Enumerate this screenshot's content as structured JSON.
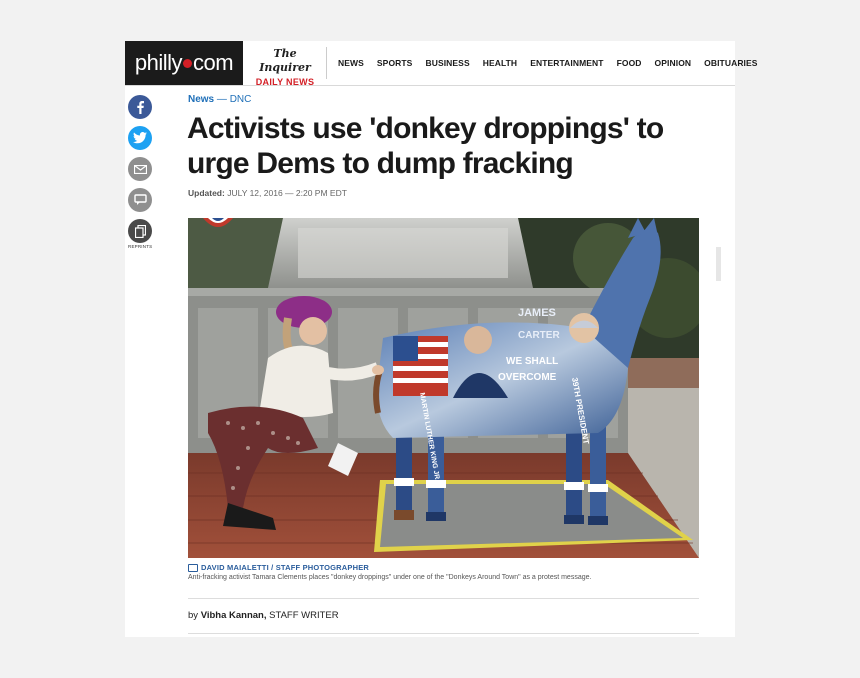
{
  "masthead": {
    "logo_left": "philly",
    "logo_right": "com",
    "partner_line1": "The Inquirer",
    "partner_line2": "DAILY NEWS"
  },
  "nav": {
    "items": [
      "NEWS",
      "SPORTS",
      "BUSINESS",
      "HEALTH",
      "ENTERTAINMENT",
      "FOOD",
      "OPINION",
      "OBITUARIES"
    ]
  },
  "share": {
    "reprints_label": "REPRINTS"
  },
  "article": {
    "section": "News",
    "separator": "—",
    "subsection": "DNC",
    "headline": "Activists use 'donkey droppings' to urge Dems to dump fracking",
    "updated_label": "Updated:",
    "updated_value": "JULY 12, 2016 — 2:20 PM EDT",
    "photo_credit": "DAVID MAIALETTI / STAFF PHOTOGRAPHER",
    "caption": "Anti-fracking activist Tamara Clements places \"donkey droppings\" under one of the \"Donkeys Around Town\" as a protest message.",
    "byline_prefix": "by",
    "byline_name": "Vibha Kannan,",
    "byline_role": "STAFF WRITER"
  },
  "photo_text": {
    "statue_top": "JAMES",
    "statue_mid": "CARTER",
    "statue_quote1": "WE SHALL",
    "statue_quote2": "OVERCOME",
    "statue_leg1": "39TH PRESIDENT",
    "statue_leg2": "MARTIN LUTHER KING JR."
  },
  "colors": {
    "accent_blue": "#1e6fb8",
    "brand_red": "#d31f26",
    "facebook": "#3b5998",
    "twitter": "#1da1f2"
  }
}
